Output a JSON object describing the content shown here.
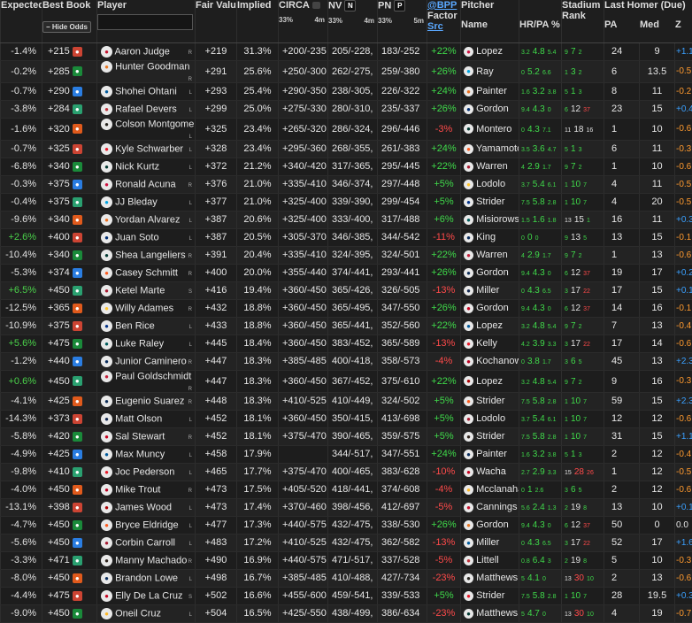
{
  "headers": {
    "expected_value": "Expected Value",
    "best_book": "Best Book",
    "hide_odds": "Hide Odds",
    "player": "Player",
    "fair_value": "Fair Value",
    "implied": "Implied",
    "circa": "CIRCA",
    "nv": "NV",
    "pn": "PN",
    "bpp": "@BPP",
    "factor": "Factor",
    "src": "Src",
    "pitcher": "Pitcher",
    "name": "Name",
    "hrpa": "HR/PA %",
    "stadium": "Stadium",
    "rank": "Rank",
    "last_homer": "Last Homer (Due)",
    "pa": "PA",
    "med": "Med",
    "z": "Z",
    "circa_pct": "33%",
    "circa_time": "4m",
    "nv_pct": "33%",
    "nv_time": "4m",
    "pn_pct": "33%",
    "pn_time": "5m"
  },
  "colors": {
    "green": "#3fd94a",
    "red": "#ff4a4a",
    "blue": "#3aa0ff",
    "orange": "#ff9a2e"
  },
  "rows": [
    {
      "ev": "-1.4%",
      "book": "+215",
      "player": "Aaron Judge",
      "hand": "R",
      "fair": "+219",
      "impl": "31.3%",
      "circa": "+200/-235",
      "nv": "205/-228,",
      "pn": "183/-252",
      "fac": "+22%",
      "pitcher": "Lopez",
      "s1": "3.2",
      "s2": "4.8",
      "s3": "5.4",
      "st1": "9",
      "st2": "7",
      "st3": "2",
      "pa": "24",
      "med": "9",
      "z": "+1.1"
    },
    {
      "ev": "-0.2%",
      "book": "+285",
      "player": "Hunter Goodman",
      "hand": "R",
      "fair": "+291",
      "impl": "25.6%",
      "circa": "+250/-300",
      "nv": "262/-275,",
      "pn": "259/-380",
      "fac": "+26%",
      "pitcher": "Ray",
      "s1": "0",
      "s2": "5.2",
      "s3": "6.6",
      "st1": "1",
      "st2": "3",
      "st3": "2",
      "pa": "6",
      "med": "13.5",
      "z": "-0.5"
    },
    {
      "ev": "-0.7%",
      "book": "+290",
      "player": "Shohei Ohtani",
      "hand": "L",
      "fair": "+293",
      "impl": "25.4%",
      "circa": "+290/-350",
      "nv": "238/-305,",
      "pn": "226/-322",
      "fac": "+24%",
      "pitcher": "Painter",
      "s1": "1.6",
      "s2": "3.2",
      "s3": "3.8",
      "st1": "5",
      "st2": "1",
      "st3": "3",
      "pa": "8",
      "med": "11",
      "z": "-0.2"
    },
    {
      "ev": "-3.8%",
      "book": "+284",
      "player": "Rafael Devers",
      "hand": "L",
      "fair": "+299",
      "impl": "25.0%",
      "circa": "+275/-330",
      "nv": "280/-310,",
      "pn": "235/-337",
      "fac": "+26%",
      "pitcher": "Gordon",
      "s1": "9.4",
      "s2": "4.3",
      "s3": "0",
      "st1": "6",
      "st2": "12",
      "st3": "37",
      "pa": "23",
      "med": "15",
      "z": "+0.4"
    },
    {
      "ev": "-1.6%",
      "book": "+320",
      "player": "Colson Montgome…",
      "hand": "L",
      "fair": "+325",
      "impl": "23.4%",
      "circa": "+265/-320",
      "nv": "286/-324,",
      "pn": "296/-446",
      "fac": "-3%",
      "pitcher": "Montero",
      "s1": "0",
      "s2": "4.3",
      "s3": "7.1",
      "st1": "11",
      "st2": "18",
      "st3": "16",
      "pa": "1",
      "med": "10",
      "z": "-0.6"
    },
    {
      "ev": "-0.7%",
      "book": "+325",
      "player": "Kyle Schwarber",
      "hand": "L",
      "fair": "+328",
      "impl": "23.4%",
      "circa": "+295/-360",
      "nv": "268/-355,",
      "pn": "261/-383",
      "fac": "+24%",
      "pitcher": "Yamamoto",
      "s1": "3.5",
      "s2": "3.6",
      "s3": "4.7",
      "st1": "5",
      "st2": "1",
      "st3": "3",
      "pa": "6",
      "med": "11",
      "z": "-0.3"
    },
    {
      "ev": "-6.8%",
      "book": "+340",
      "player": "Nick Kurtz",
      "hand": "L",
      "fair": "+372",
      "impl": "21.2%",
      "circa": "+340/-420",
      "nv": "317/-365,",
      "pn": "295/-445",
      "fac": "+22%",
      "pitcher": "Warren",
      "s1": "4",
      "s2": "2.9",
      "s3": "1.7",
      "st1": "9",
      "st2": "7",
      "st3": "2",
      "pa": "1",
      "med": "10",
      "z": "-0.6"
    },
    {
      "ev": "-0.3%",
      "book": "+375",
      "player": "Ronald Acuna",
      "hand": "R",
      "fair": "+376",
      "impl": "21.0%",
      "circa": "+335/-410",
      "nv": "346/-374,",
      "pn": "297/-448",
      "fac": "+5%",
      "pitcher": "Lodolo",
      "s1": "3.7",
      "s2": "5.4",
      "s3": "6.1",
      "st1": "1",
      "st2": "10",
      "st3": "7",
      "pa": "4",
      "med": "11",
      "z": "-0.5"
    },
    {
      "ev": "-0.4%",
      "book": "+375",
      "player": "JJ Bleday",
      "hand": "L",
      "fair": "+377",
      "impl": "21.0%",
      "circa": "+325/-400",
      "nv": "339/-390,",
      "pn": "299/-454",
      "fac": "+5%",
      "pitcher": "Strider",
      "s1": "7.5",
      "s2": "5.8",
      "s3": "2.8",
      "st1": "1",
      "st2": "10",
      "st3": "7",
      "pa": "4",
      "med": "20",
      "z": "-0.5"
    },
    {
      "ev": "-9.6%",
      "book": "+340",
      "player": "Yordan Alvarez",
      "hand": "L",
      "fair": "+387",
      "impl": "20.6%",
      "circa": "+325/-400",
      "nv": "333/-400,",
      "pn": "317/-488",
      "fac": "+6%",
      "pitcher": "Misiorowski",
      "s1": "1.5",
      "s2": "1.6",
      "s3": "1.8",
      "st1": "13",
      "st2": "15",
      "st3": "1",
      "pa": "16",
      "med": "11",
      "z": "+0.3"
    },
    {
      "ev": "+2.6%",
      "book": "+400",
      "player": "Juan Soto",
      "hand": "L",
      "fair": "+387",
      "impl": "20.5%",
      "circa": "+305/-370",
      "nv": "346/-385,",
      "pn": "344/-542",
      "fac": "-11%",
      "pitcher": "King",
      "s1": "0",
      "s2": "0",
      "s3": "0",
      "st1": "9",
      "st2": "13",
      "st3": "5",
      "pa": "13",
      "med": "15",
      "z": "-0.1"
    },
    {
      "ev": "-10.4%",
      "book": "+340",
      "player": "Shea Langeliers",
      "hand": "R",
      "fair": "+391",
      "impl": "20.4%",
      "circa": "+335/-410",
      "nv": "324/-395,",
      "pn": "324/-501",
      "fac": "+22%",
      "pitcher": "Warren",
      "s1": "4",
      "s2": "2.9",
      "s3": "1.7",
      "st1": "9",
      "st2": "7",
      "st3": "2",
      "pa": "1",
      "med": "13",
      "z": "-0.6"
    },
    {
      "ev": "-5.3%",
      "book": "+374",
      "player": "Casey Schmitt",
      "hand": "R",
      "fair": "+400",
      "impl": "20.0%",
      "circa": "+355/-440",
      "nv": "374/-441,",
      "pn": "293/-441",
      "fac": "+26%",
      "pitcher": "Gordon",
      "s1": "9.4",
      "s2": "4.3",
      "s3": "0",
      "st1": "6",
      "st2": "12",
      "st3": "37",
      "pa": "19",
      "med": "17",
      "z": "+0.2"
    },
    {
      "ev": "+6.5%",
      "book": "+450",
      "player": "Ketel Marte",
      "hand": "S",
      "fair": "+416",
      "impl": "19.4%",
      "circa": "+360/-450",
      "nv": "365/-426,",
      "pn": "326/-505",
      "fac": "-13%",
      "pitcher": "Miller",
      "s1": "0",
      "s2": "4.3",
      "s3": "6.5",
      "st1": "3",
      "st2": "17",
      "st3": "22",
      "pa": "17",
      "med": "15",
      "z": "+0.1"
    },
    {
      "ev": "-12.5%",
      "book": "+365",
      "player": "Willy Adames",
      "hand": "R",
      "fair": "+432",
      "impl": "18.8%",
      "circa": "+360/-450",
      "nv": "365/-495,",
      "pn": "347/-550",
      "fac": "+26%",
      "pitcher": "Gordon",
      "s1": "9.4",
      "s2": "4.3",
      "s3": "0",
      "st1": "6",
      "st2": "12",
      "st3": "37",
      "pa": "14",
      "med": "16",
      "z": "-0.1"
    },
    {
      "ev": "-10.9%",
      "book": "+375",
      "player": "Ben Rice",
      "hand": "L",
      "fair": "+433",
      "impl": "18.8%",
      "circa": "+360/-450",
      "nv": "365/-441,",
      "pn": "352/-560",
      "fac": "+22%",
      "pitcher": "Lopez",
      "s1": "3.2",
      "s2": "4.8",
      "s3": "5.4",
      "st1": "9",
      "st2": "7",
      "st3": "2",
      "pa": "7",
      "med": "13",
      "z": "-0.4"
    },
    {
      "ev": "+5.6%",
      "book": "+475",
      "player": "Luke Raley",
      "hand": "L",
      "fair": "+445",
      "impl": "18.4%",
      "circa": "+360/-450",
      "nv": "383/-452,",
      "pn": "365/-589",
      "fac": "-13%",
      "pitcher": "Kelly",
      "s1": "4.2",
      "s2": "3.9",
      "s3": "3.3",
      "st1": "3",
      "st2": "17",
      "st3": "22",
      "pa": "17",
      "med": "14",
      "z": "-0.6"
    },
    {
      "ev": "-1.2%",
      "book": "+440",
      "player": "Junior Caminero",
      "hand": "R",
      "fair": "+447",
      "impl": "18.3%",
      "circa": "+385/-485",
      "nv": "400/-418,",
      "pn": "358/-573",
      "fac": "-4%",
      "pitcher": "Kochanowicz",
      "s1": "0",
      "s2": "3.8",
      "s3": "1.7",
      "st1": "3",
      "st2": "6",
      "st3": "5",
      "pa": "45",
      "med": "13",
      "z": "+2.3"
    },
    {
      "ev": "+0.6%",
      "book": "+450",
      "player": "Paul Goldschmidt",
      "hand": "R",
      "fair": "+447",
      "impl": "18.3%",
      "circa": "+360/-450",
      "nv": "367/-452,",
      "pn": "375/-610",
      "fac": "+22%",
      "pitcher": "Lopez",
      "s1": "3.2",
      "s2": "4.8",
      "s3": "5.4",
      "st1": "9",
      "st2": "7",
      "st3": "2",
      "pa": "9",
      "med": "16",
      "z": "-0.3"
    },
    {
      "ev": "-4.1%",
      "book": "+425",
      "player": "Eugenio Suarez",
      "hand": "R",
      "fair": "+448",
      "impl": "18.3%",
      "circa": "+410/-525",
      "nv": "410/-449,",
      "pn": "324/-502",
      "fac": "+5%",
      "pitcher": "Strider",
      "s1": "7.5",
      "s2": "5.8",
      "s3": "2.8",
      "st1": "1",
      "st2": "10",
      "st3": "7",
      "pa": "59",
      "med": "15",
      "z": "+2.3"
    },
    {
      "ev": "-14.3%",
      "book": "+373",
      "player": "Matt Olson",
      "hand": "L",
      "fair": "+452",
      "impl": "18.1%",
      "circa": "+360/-450",
      "nv": "350/-415,",
      "pn": "413/-698",
      "fac": "+5%",
      "pitcher": "Lodolo",
      "s1": "3.7",
      "s2": "5.4",
      "s3": "6.1",
      "st1": "1",
      "st2": "10",
      "st3": "7",
      "pa": "12",
      "med": "12",
      "z": "-0.6"
    },
    {
      "ev": "-5.8%",
      "book": "+420",
      "player": "Sal Stewart",
      "hand": "R",
      "fair": "+452",
      "impl": "18.1%",
      "circa": "+375/-470",
      "nv": "390/-465,",
      "pn": "359/-575",
      "fac": "+5%",
      "pitcher": "Strider",
      "s1": "7.5",
      "s2": "5.8",
      "s3": "2.8",
      "st1": "1",
      "st2": "10",
      "st3": "7",
      "pa": "31",
      "med": "15",
      "z": "+1.1"
    },
    {
      "ev": "-4.9%",
      "book": "+425",
      "player": "Max Muncy",
      "hand": "L",
      "fair": "+458",
      "impl": "17.9%",
      "circa": "",
      "nv": "344/-517,",
      "pn": "347/-551",
      "fac": "+24%",
      "pitcher": "Painter",
      "s1": "1.6",
      "s2": "3.2",
      "s3": "3.8",
      "st1": "5",
      "st2": "1",
      "st3": "3",
      "pa": "2",
      "med": "12",
      "z": "-0.4"
    },
    {
      "ev": "-9.8%",
      "book": "+410",
      "player": "Joc Pederson",
      "hand": "L",
      "fair": "+465",
      "impl": "17.7%",
      "circa": "+375/-470",
      "nv": "400/-465,",
      "pn": "383/-628",
      "fac": "-10%",
      "pitcher": "Wacha",
      "s1": "2.7",
      "s2": "2.9",
      "s3": "3.3",
      "st1": "15",
      "st2": "28",
      "st3": "26",
      "pa": "1",
      "med": "12",
      "z": "-0.5"
    },
    {
      "ev": "-4.0%",
      "book": "+450",
      "player": "Mike Trout",
      "hand": "R",
      "fair": "+473",
      "impl": "17.5%",
      "circa": "+405/-520",
      "nv": "418/-441,",
      "pn": "374/-608",
      "fac": "-4%",
      "pitcher": "Mcclanahan",
      "s1": "0",
      "s2": "1",
      "s3": "2.6",
      "st1": "3",
      "st2": "6",
      "st3": "5",
      "pa": "2",
      "med": "12",
      "z": "-0.6"
    },
    {
      "ev": "-13.1%",
      "book": "+398",
      "player": "James Wood",
      "hand": "L",
      "fair": "+473",
      "impl": "17.4%",
      "circa": "+370/-460",
      "nv": "398/-456,",
      "pn": "412/-697",
      "fac": "-5%",
      "pitcher": "Cannings",
      "s1": "5.6",
      "s2": "2.4",
      "s3": "1.3",
      "st1": "2",
      "st2": "19",
      "st3": "8",
      "pa": "13",
      "med": "10",
      "z": "+0.1"
    },
    {
      "ev": "-4.7%",
      "book": "+450",
      "player": "Bryce Eldridge",
      "hand": "L",
      "fair": "+477",
      "impl": "17.3%",
      "circa": "+440/-575",
      "nv": "432/-475,",
      "pn": "338/-530",
      "fac": "+26%",
      "pitcher": "Gordon",
      "s1": "9.4",
      "s2": "4.3",
      "s3": "0",
      "st1": "6",
      "st2": "12",
      "st3": "37",
      "pa": "50",
      "med": "0",
      "z": "0.0"
    },
    {
      "ev": "-5.6%",
      "book": "+450",
      "player": "Corbin Carroll",
      "hand": "L",
      "fair": "+483",
      "impl": "17.2%",
      "circa": "+410/-525",
      "nv": "432/-475,",
      "pn": "362/-582",
      "fac": "-13%",
      "pitcher": "Miller",
      "s1": "0",
      "s2": "4.3",
      "s3": "6.5",
      "st1": "3",
      "st2": "17",
      "st3": "22",
      "pa": "52",
      "med": "17",
      "z": "+1.6"
    },
    {
      "ev": "-3.3%",
      "book": "+471",
      "player": "Manny Machado",
      "hand": "R",
      "fair": "+490",
      "impl": "16.9%",
      "circa": "+440/-575",
      "nv": "471/-517,",
      "pn": "337/-528",
      "fac": "-5%",
      "pitcher": "Littell",
      "s1": "0.8",
      "s2": "6.4",
      "s3": "3",
      "st1": "2",
      "st2": "19",
      "st3": "8",
      "pa": "5",
      "med": "10",
      "z": "-0.3"
    },
    {
      "ev": "-8.0%",
      "book": "+450",
      "player": "Brandon Lowe",
      "hand": "L",
      "fair": "+498",
      "impl": "16.7%",
      "circa": "+385/-485",
      "nv": "410/-488,",
      "pn": "427/-734",
      "fac": "-23%",
      "pitcher": "Matthews",
      "s1": "5",
      "s2": "4.1",
      "s3": "0",
      "st1": "13",
      "st2": "30",
      "st3": "10",
      "pa": "2",
      "med": "13",
      "z": "-0.6"
    },
    {
      "ev": "-4.4%",
      "book": "+475",
      "player": "Elly De La Cruz",
      "hand": "S",
      "fair": "+502",
      "impl": "16.6%",
      "circa": "+455/-600",
      "nv": "459/-541,",
      "pn": "339/-533",
      "fac": "+5%",
      "pitcher": "Strider",
      "s1": "7.5",
      "s2": "5.8",
      "s3": "2.8",
      "st1": "1",
      "st2": "10",
      "st3": "7",
      "pa": "28",
      "med": "19.5",
      "z": "+0.3"
    },
    {
      "ev": "-9.0%",
      "book": "+450",
      "player": "Oneil Cruz",
      "hand": "L",
      "fair": "+504",
      "impl": "16.5%",
      "circa": "+425/-550",
      "nv": "438/-499,",
      "pn": "386/-634",
      "fac": "-23%",
      "pitcher": "Matthews",
      "s1": "5",
      "s2": "4.7",
      "s3": "0",
      "st1": "13",
      "st2": "30",
      "st3": "10",
      "pa": "4",
      "med": "19",
      "z": "-0.7"
    }
  ]
}
